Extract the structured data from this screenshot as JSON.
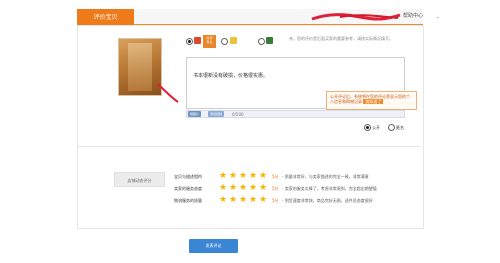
{
  "header": {
    "title": "评价宝贝",
    "right_link": "帮助中心"
  },
  "product": {
    "image_icon": "product-thumbnail-icon"
  },
  "rating": {
    "good_label": "好评",
    "badge_text": "好评\n有礼",
    "hint": "亲，您的评价是后面买家的重要参考，请按实际情况填写。"
  },
  "review": {
    "text": "书本很新没有破损，价格很实惠。",
    "tooltip": "公开评论后，系统将在您的评论旁显示您的个人信息和购物记录",
    "tooltip_btn": "我知道了",
    "toolbar": {
      "upload": "晒图片",
      "append": "添加视频",
      "count": "0/500"
    },
    "public_label": "公开",
    "anonymous_label": "匿名"
  },
  "store": {
    "button": "店铺动态评分",
    "items": [
      {
        "label": "宝贝与描述相符",
        "score": "5分",
        "desc": "- 质量非常好，与卖家描述的完全一致，非常满意"
      },
      {
        "label": "卖家的服务态度",
        "score": "5分",
        "desc": "- 卖家的服务太棒了，考虑非常周到，完全超出期望值"
      },
      {
        "label": "物流服务的质量",
        "score": "5分",
        "desc": "- 到货速度非常快，商品完好无损，送件员态度很好"
      }
    ],
    "stars": 5
  },
  "submit_label": "发表评论",
  "colors": {
    "accent": "#ee7a1a",
    "star": "#f5b400",
    "submit": "#3a86d4"
  }
}
